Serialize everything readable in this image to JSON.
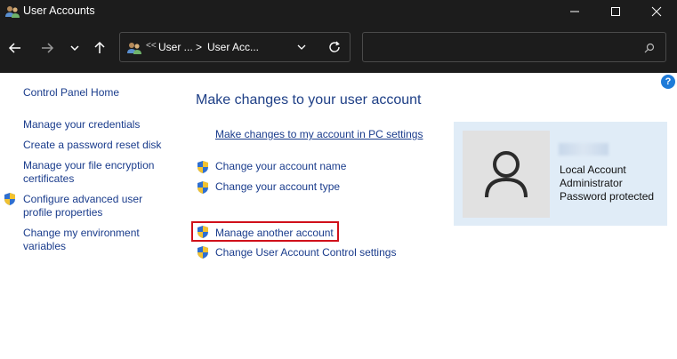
{
  "window": {
    "title": "User Accounts"
  },
  "nav": {
    "address": {
      "prefix": "<<",
      "crumb1": "User ...",
      "separator": ">",
      "crumb2": "User Acc..."
    },
    "search_placeholder": ""
  },
  "sidebar": {
    "items": [
      {
        "label": "Control Panel Home"
      },
      {
        "label": "Manage your credentials"
      },
      {
        "label": "Create a password reset disk"
      },
      {
        "label": "Manage your file encryption certificates"
      },
      {
        "label": "Configure advanced user profile properties"
      },
      {
        "label": "Change my environment variables"
      }
    ]
  },
  "main": {
    "heading": "Make changes to your user account",
    "pc_settings_link": "Make changes to my account in PC settings",
    "links": [
      {
        "label": "Change your account name"
      },
      {
        "label": "Change your account type"
      },
      {
        "label": "Manage another account"
      },
      {
        "label": "Change User Account Control settings"
      }
    ]
  },
  "account": {
    "lines": [
      "Local Account",
      "Administrator",
      "Password protected"
    ]
  },
  "help_label": "?",
  "colors": {
    "titlebar_bg": "#1c1c1c",
    "link": "#1a3c8c",
    "heading": "#1e3f86",
    "panel_bg": "#e0ecf7",
    "highlight": "#d0101a"
  },
  "icons": [
    "users-icon",
    "minimize-icon",
    "maximize-icon",
    "close-icon",
    "back-arrow-icon",
    "forward-arrow-icon",
    "chevron-down-icon",
    "up-arrow-icon",
    "refresh-icon",
    "search-icon",
    "shield-icon",
    "user-avatar-icon",
    "help-icon"
  ]
}
